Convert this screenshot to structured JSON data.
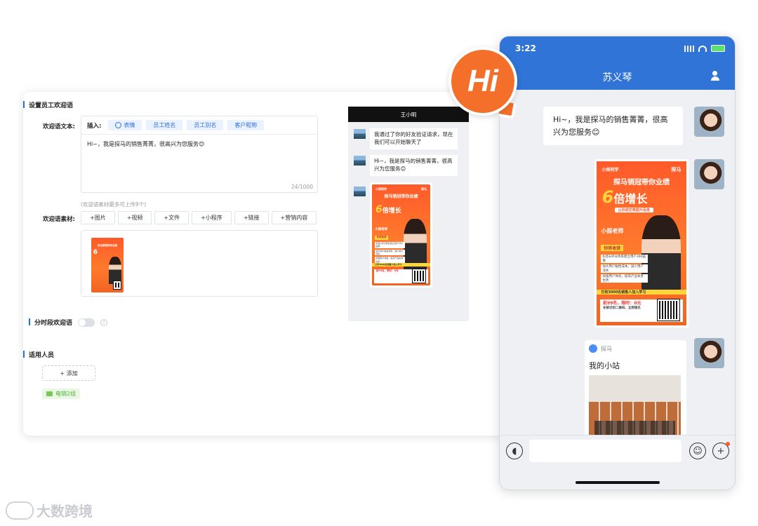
{
  "admin": {
    "section_welcome": "设置员工欢迎语",
    "welcome_text_label": "欢迎语文本:",
    "insert_label": "插入:",
    "insert_chips": [
      "表情",
      "员工姓名",
      "员工别名",
      "客户昵称"
    ],
    "welcome_text": "Hi~，我是探马的销售菁菁，很高兴为您服务😊",
    "counter": "24/1000",
    "material_hint": "(欢迎语素材最多可上传9个)",
    "material_label": "欢迎语素材:",
    "material_buttons": [
      "+图片",
      "+视频",
      "+文件",
      "+小程序",
      "+链接",
      "+营销内容"
    ],
    "section_time": "分时段欢迎语",
    "section_people": "适用人员",
    "add_button": "+ 添加",
    "group_tag": "电销2组"
  },
  "poster": {
    "brand": "小探同学",
    "logo": "探马",
    "title": "探马销冠带你业绩",
    "big_number": "6",
    "big_text": "倍增长",
    "subtitle": "让你成交率提升百倍",
    "teacher": "小探老师",
    "tag": "你将收获",
    "points": [
      "标签&评分体系建立用户360画像",
      "加大用户黏性成本，减少用户流失",
      "加强用户体验，提高产品本身优势"
    ],
    "band": "已有3000名销售人加入学习",
    "price": "前99名，限时：0元",
    "scan": "长按识别二维码，立即报名"
  },
  "preview": {
    "header": "王小明",
    "messages": [
      "我通过了你的好友验证请求，现在我们可以开始聊天了",
      "Hi~，我是探马的销售菁菁，很高兴为您服务😊"
    ]
  },
  "phone": {
    "time": "3:22",
    "contact_name": "苏义琴",
    "greeting": "Hi~，我是探马的销售菁菁，很高兴为您服务😊",
    "link_source": "探马",
    "link_title": "我的小站"
  },
  "badge": {
    "text": "Hi"
  },
  "watermark": {
    "text": "大数跨境"
  }
}
